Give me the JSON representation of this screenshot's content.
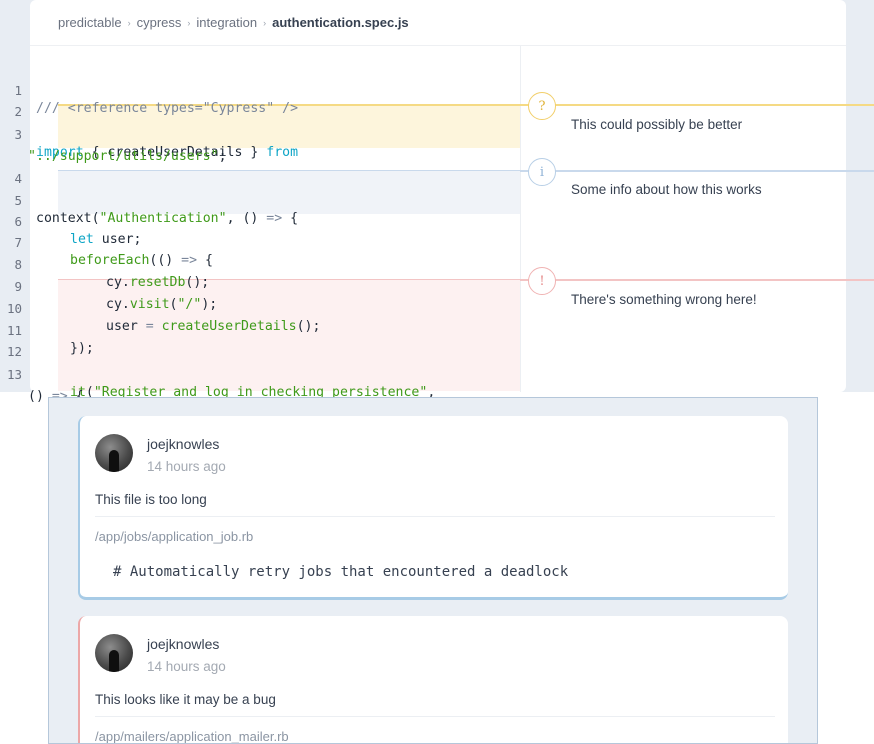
{
  "breadcrumb": {
    "items": [
      "predictable",
      "cypress",
      "integration"
    ],
    "current": "authentication.spec.js",
    "separator": "›"
  },
  "code": {
    "l1": "1",
    "l2": "2",
    "l3": "3",
    "l4": "4",
    "l5": "5",
    "l6": "6",
    "l7": "7",
    "l8": "8",
    "l9": "9",
    "l10": "10",
    "l11": "11",
    "l12": "12",
    "l13": "13",
    "t1": "/// <reference types=\"Cypress\" />",
    "t3_kw1": "import",
    "t3_mid": " { createUserDetails } ",
    "t3_kw2": "from",
    "t3b_str": "\"../support/utils/users\"",
    "t3b_end": ";",
    "t5_a": "context(",
    "t5_str": "\"Authentication\"",
    "t5_b": ", () ",
    "t5_op": "=>",
    "t5_c": " {",
    "t6_kw": "let",
    "t6_rest": " user;",
    "t7_fn": "beforeEach",
    "t7_a": "(() ",
    "t7_op": "=>",
    "t7_b": " {",
    "t8_a": "cy.",
    "t8_fn": "resetDb",
    "t8_b": "();",
    "t9_a": "cy.",
    "t9_fn": "visit",
    "t9_b": "(",
    "t9_str": "\"/\"",
    "t9_c": ");",
    "t10_a": "user ",
    "t10_op": "=",
    "t10_b": " ",
    "t10_fn": "createUserDetails",
    "t10_c": "();",
    "t11": "});",
    "t13_fn": "it",
    "t13_a": "(",
    "t13_str": "\"Register and log in checking persistence\"",
    "t13_b": ",",
    "t13b_a": "() ",
    "t13b_op": "=>",
    "t13b_b": " {"
  },
  "annotations": [
    {
      "icon": "?",
      "text": "This could possibly be better",
      "color": "#f2cf6b"
    },
    {
      "icon": "i",
      "text": "Some info about how this works",
      "color": "#b8cfe6"
    },
    {
      "icon": "!",
      "text": "There's something wrong here!",
      "color": "#f0b3b3"
    }
  ],
  "comments": [
    {
      "user": "joejknowles",
      "time": "14 hours ago",
      "body": "This file is too long",
      "path": "/app/jobs/application_job.rb",
      "code": "# Automatically retry jobs that encountered a deadlock"
    },
    {
      "user": "joejknowles",
      "time": "14 hours ago",
      "body": "This looks like it may be a bug",
      "path": "/app/mailers/application_mailer.rb"
    }
  ]
}
